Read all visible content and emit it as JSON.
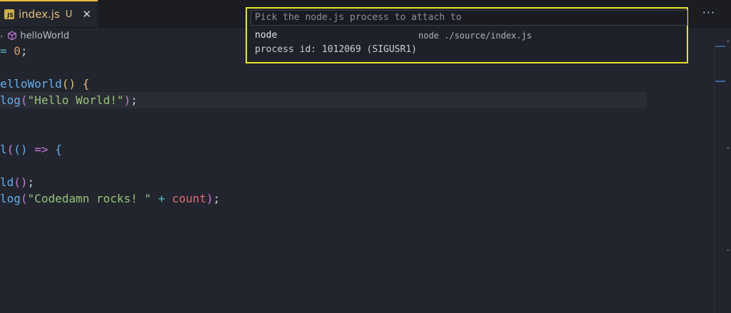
{
  "tab": {
    "label": "index.js",
    "status": "U",
    "close": "✕",
    "file_icon": "JS"
  },
  "tab_actions": {
    "split": "]",
    "more": "···"
  },
  "breadcrumb": {
    "symbol": "helloWorld"
  },
  "code_lines": [
    "= 0;",
    "",
    "elloWorld() {",
    "log(\"Hello World!\");",
    "",
    "",
    "l(() => {",
    "",
    "ld();",
    "log(\"Codedamn rocks! \" + count);"
  ],
  "quick_pick": {
    "placeholder": "Pick the node.js process to attach to",
    "items": [
      {
        "label": "node",
        "description": "node ./source/index.js",
        "detail": "process id: 1012069 (SIGUSR1)"
      }
    ]
  },
  "colors": {
    "accent_border": "#e8e12f",
    "tab_accent": "#e7b844",
    "editor_bg": "#22252d"
  }
}
